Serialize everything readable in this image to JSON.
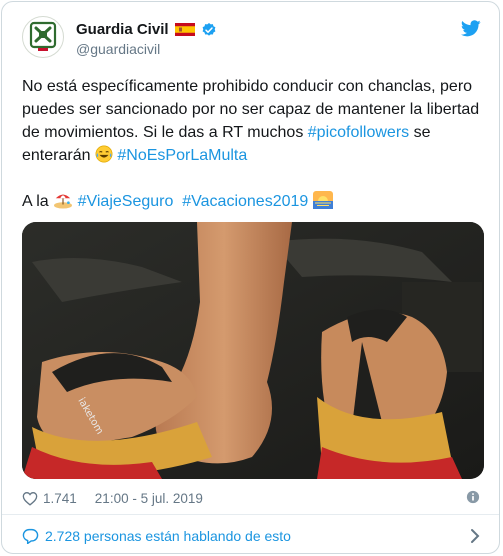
{
  "author": {
    "display_name": "Guardia Civil",
    "handle": "@guardiacivil",
    "verified": true,
    "avatar_icon": "guardia-civil-emblem-icon",
    "flag_icon": "spain-flag-icon"
  },
  "tweet": {
    "text_part1": "No está específicamente prohibido conducir con chanclas, pero puedes ser sancionado por no ser capaz de mantener la libertad de movimientos. Si le das a RT muchos ",
    "hashtag_picofollowers": "#picofollowers",
    "text_part2": " se enterarán ",
    "hashtag_noesporlamulta": "#NoEsPorLaMulta",
    "line2_prefix": "A la ",
    "hashtag_viajeseguro": "#ViajeSeguro",
    "hashtag_vacaciones": "#Vacaciones2019",
    "emojis": [
      "laughing-tears-emoji",
      "beach-umbrella-emoji",
      "sunrise-emoji"
    ]
  },
  "meta": {
    "likes": "1.741",
    "timestamp": "21:00 - 5 jul. 2019"
  },
  "conversation": {
    "label": "2.728 personas están hablando de esto"
  },
  "colors": {
    "link": "#1b95e0",
    "secondary_text": "#657786",
    "border": "#cfd9de",
    "verified": "#1da1f2"
  }
}
